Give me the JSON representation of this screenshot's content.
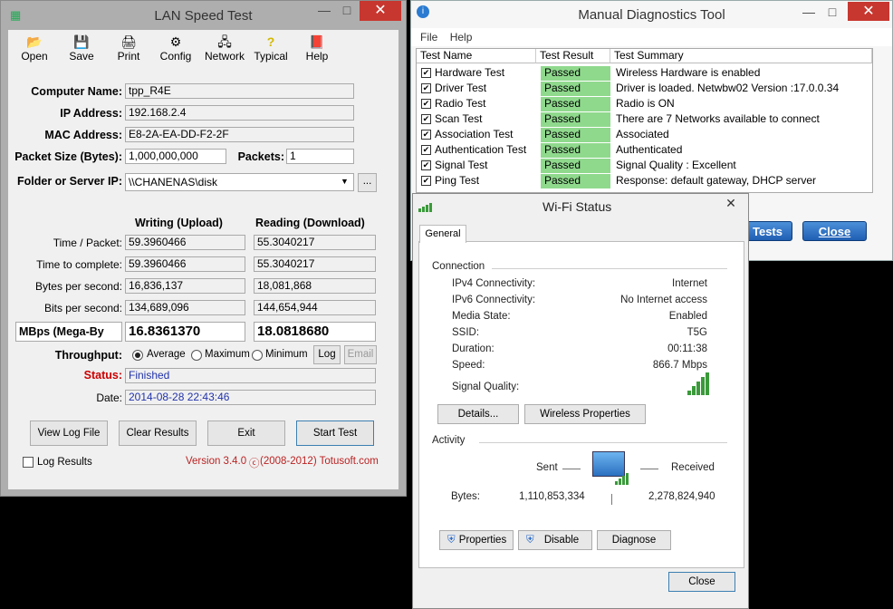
{
  "lst": {
    "title": "LAN Speed Test",
    "toolbar": [
      "Open",
      "Save",
      "Print",
      "Config",
      "Network",
      "Typical",
      "Help"
    ],
    "computer_name_label": "Computer Name:",
    "computer_name": "tpp_R4E",
    "ip_label": "IP Address:",
    "ip": "192.168.2.4",
    "mac_label": "MAC Address:",
    "mac": "E8-2A-EA-DD-F2-2F",
    "packet_size_label": "Packet Size (Bytes):",
    "packet_size": "1,000,000,000",
    "packets_label": "Packets:",
    "packets": "1",
    "folder_label": "Folder or Server IP:",
    "folder": "\\\\CHANENAS\\disk",
    "browse": "...",
    "writing_header": "Writing (Upload)",
    "reading_header": "Reading (Download)",
    "time_packet_label": "Time / Packet:",
    "time_packet_w": "59.3960466",
    "time_packet_r": "55.3040217",
    "time_complete_label": "Time to complete:",
    "time_complete_w": "59.3960466",
    "time_complete_r": "55.3040217",
    "bytes_sec_label": "Bytes per second:",
    "bytes_sec_w": "16,836,137",
    "bytes_sec_r": "18,081,868",
    "bits_sec_label": "Bits per second:",
    "bits_sec_w": "134,689,096",
    "bits_sec_r": "144,654,944",
    "unit_select": "MBps (Mega-By",
    "mbps_w": "16.8361370",
    "mbps_r": "18.0818680",
    "throughput_label": "Throughput:",
    "opt_average": "Average",
    "opt_maximum": "Maximum",
    "opt_minimum": "Minimum",
    "log_btn": "Log",
    "email_btn": "Email",
    "status_label": "Status:",
    "status": "Finished",
    "date_label": "Date:",
    "date": "2014-08-28 22:43:46",
    "btn_view_log": "View Log File",
    "btn_clear": "Clear Results",
    "btn_exit": "Exit",
    "btn_start": "Start Test",
    "log_results": "Log Results",
    "version": "Version 3.4.0",
    "copyright": "(2008-2012) Totusoft.com"
  },
  "mdt": {
    "title": "Manual Diagnostics Tool",
    "menu": [
      "File",
      "Help"
    ],
    "headers": [
      "Test Name",
      "Test Result",
      "Test Summary"
    ],
    "rows": [
      {
        "name": "Hardware Test",
        "result": "Passed",
        "summary": "Wireless Hardware is enabled"
      },
      {
        "name": "Driver Test",
        "result": "Passed",
        "summary": "Driver is loaded. Netwbw02 Version :17.0.0.34"
      },
      {
        "name": "Radio Test",
        "result": "Passed",
        "summary": "Radio is ON"
      },
      {
        "name": "Scan Test",
        "result": "Passed",
        "summary": "There are 7 Networks available to connect"
      },
      {
        "name": "Association Test",
        "result": "Passed",
        "summary": "Associated"
      },
      {
        "name": "Authentication Test",
        "result": "Passed",
        "summary": "Authenticated"
      },
      {
        "name": "Signal Test",
        "result": "Passed",
        "summary": "Signal Quality : Excellent"
      },
      {
        "name": "Ping Test",
        "result": "Passed",
        "summary": "Response: default gateway, DHCP server"
      }
    ],
    "btn_tests": "Tests",
    "btn_close": "Close"
  },
  "wifi": {
    "title": "Wi-Fi Status",
    "tab": "General",
    "connection": "Connection",
    "ipv4_label": "IPv4 Connectivity:",
    "ipv4": "Internet",
    "ipv6_label": "IPv6 Connectivity:",
    "ipv6": "No Internet access",
    "media_label": "Media State:",
    "media": "Enabled",
    "ssid_label": "SSID:",
    "ssid": "T5G",
    "duration_label": "Duration:",
    "duration": "00:11:38",
    "speed_label": "Speed:",
    "speed": "866.7 Mbps",
    "signal_label": "Signal Quality:",
    "btn_details": "Details...",
    "btn_wireless": "Wireless Properties",
    "activity": "Activity",
    "sent": "Sent",
    "received": "Received",
    "bytes_label": "Bytes:",
    "bytes_sent": "1,110,853,334",
    "bytes_received": "2,278,824,940",
    "btn_properties": "Properties",
    "btn_disable": "Disable",
    "btn_diagnose": "Diagnose",
    "btn_close": "Close"
  }
}
